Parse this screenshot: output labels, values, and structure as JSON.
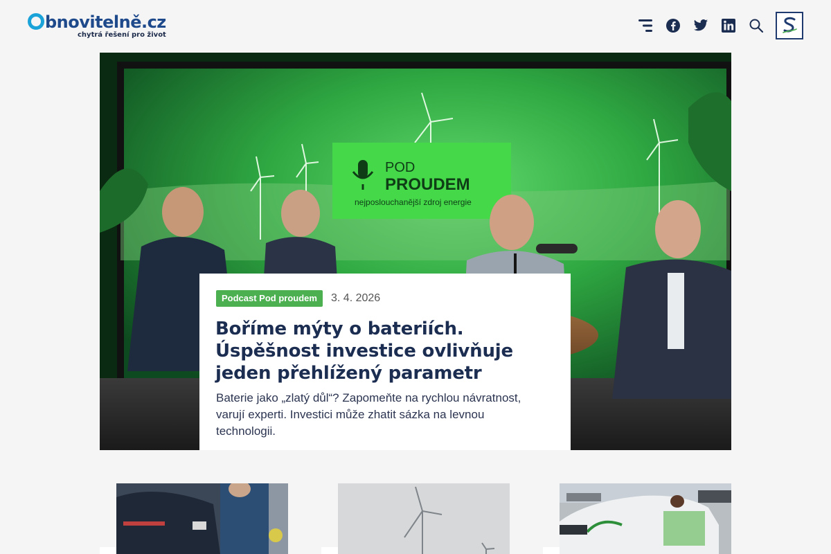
{
  "header": {
    "logo": {
      "brand_rest": "bnovitelně.cz",
      "tagline": "chytrá řešení pro život"
    },
    "icons": [
      "menu-icon",
      "facebook-icon",
      "twitter-icon",
      "linkedin-icon",
      "search-icon"
    ],
    "partner_logo": "S"
  },
  "hero": {
    "tag": "Podcast Pod proudem",
    "date": "3. 4. 2026",
    "title": "Boříme mýty o bateriích. Úspěšnost investice ovlivňuje jeden přehlížený parametr",
    "perex": "Baterie jako „zlatý důl“? Zapomeňte na rychlou návratnost, varují experti. Investici může zhatit sázka na levnou technologii.",
    "screen": {
      "line1": "POD",
      "line2": "PROUDEM",
      "line3": "nejposlouchanější zdroj energie"
    }
  },
  "cards": [
    {
      "image": "electric-car-charging-photo"
    },
    {
      "image": "wind-turbines-fog-photo"
    },
    {
      "image": "branded-electric-car-photo"
    }
  ],
  "colors": {
    "brand_blue": "#1e4a8c",
    "logo_ring": "#1aa3d9",
    "badge_green": "#4caf50",
    "title_navy": "#1c2d52"
  }
}
